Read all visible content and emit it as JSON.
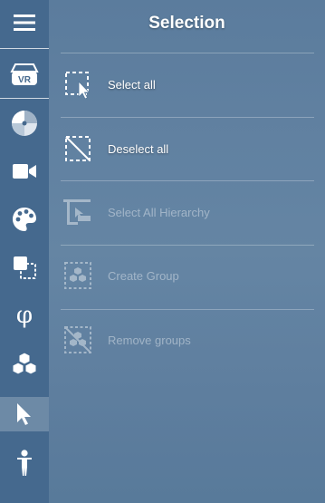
{
  "panel": {
    "title": "Selection"
  },
  "sidebar": {
    "items": [
      {
        "icon": "menu-icon",
        "active": false
      },
      {
        "icon": "vr-headset-icon",
        "label": "VR",
        "active": false
      },
      {
        "icon": "disc-icon",
        "active": false
      },
      {
        "icon": "video-camera-icon",
        "active": false
      },
      {
        "icon": "palette-icon",
        "active": false
      },
      {
        "icon": "transform-icon",
        "active": false
      },
      {
        "icon": "phi-icon",
        "label": "φ",
        "active": false
      },
      {
        "icon": "cubes-icon",
        "active": false
      },
      {
        "icon": "cursor-icon",
        "active": true
      },
      {
        "icon": "person-icon",
        "active": false
      }
    ]
  },
  "actions": [
    {
      "label": "Select all",
      "icon": "select-all-icon",
      "enabled": true
    },
    {
      "label": "Deselect all",
      "icon": "deselect-all-icon",
      "enabled": true
    },
    {
      "label": "Select All Hierarchy",
      "icon": "hierarchy-icon",
      "enabled": false
    },
    {
      "label": "Create Group",
      "icon": "create-group-icon",
      "enabled": false
    },
    {
      "label": "Remove groups",
      "icon": "remove-groups-icon",
      "enabled": false
    }
  ],
  "colors": {
    "sidebar_bg": "#45698e",
    "panel_bg": "#55799c",
    "active_item_bg": "#7f9ab6",
    "text": "#ffffff"
  }
}
